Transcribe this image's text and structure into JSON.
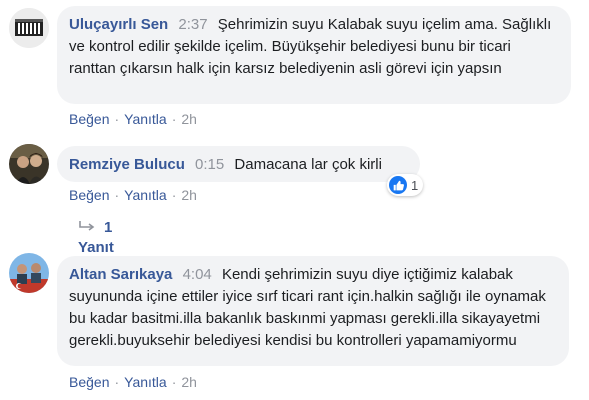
{
  "comments": [
    {
      "author": "Uluçayırlı Sen",
      "time": "2:37",
      "text": "Şehrimizin suyu Kalabak suyu içelim ama. Sağlıklı ve kontrol edilir şekilde içelim. Büyükşehir belediyesi bunu bir ticari ranttan çıkarsın halk için karsız belediyenin asli görevi için yapsın",
      "like_label": "Beğen",
      "reply_label": "Yanıtla",
      "age": "2h"
    },
    {
      "author": "Remziye Bulucu",
      "time": "0:15",
      "text": "Damacana lar çok kirli",
      "like_label": "Beğen",
      "reply_label": "Yanıtla",
      "age": "2h",
      "reaction_count": "1",
      "replies_label": "1 Yanıt"
    },
    {
      "author": "Altan Sarıkaya",
      "time": "4:04",
      "text": "Kendi şehrimizin suyu diye içtiğimiz kalabak suyununda içine ettiler iyice sırf ticari rant için.halkin sağlığı ile oynamak bu kadar basitmi.illa bakanlık baskınmi yapması gerekli.illa sikayayetmi gerekli.buyuksehir belediyesi kendisi bu kontrolleri yapamamiyormu",
      "like_label": "Beğen",
      "reply_label": "Yanıtla",
      "age": "2h"
    }
  ],
  "colors": {
    "link": "#385898",
    "muted": "#90949c",
    "bubble": "#f2f3f5",
    "like_blue": "#1877f2"
  }
}
